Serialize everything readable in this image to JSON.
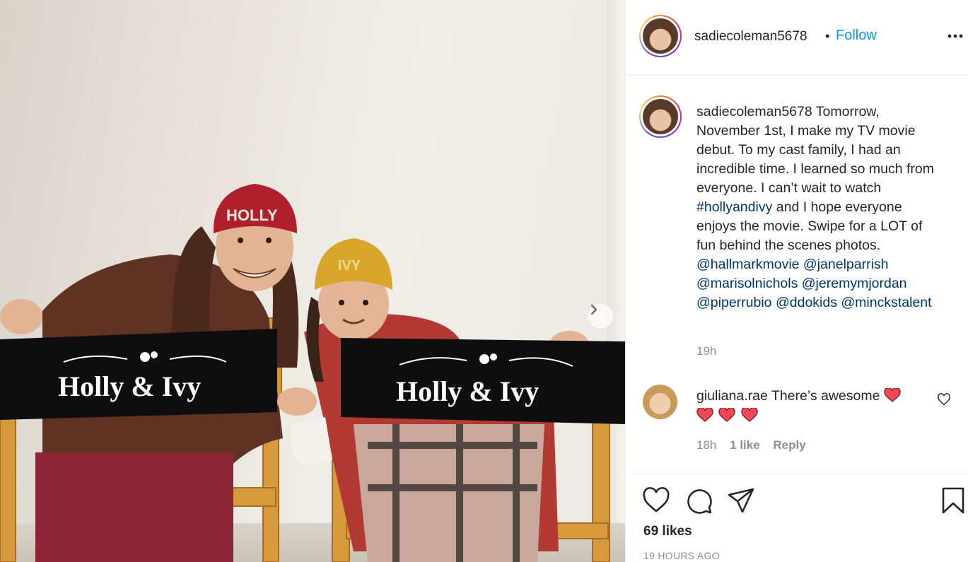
{
  "photo": {
    "alt": "",
    "beanie_left": "HOLLY",
    "beanie_right": "IVY",
    "chair_text": "Holly & Ivy"
  },
  "header": {
    "username": "sadiecoleman5678",
    "separator": "•",
    "follow_label": "Follow",
    "more_icon": "more-horizontal-icon"
  },
  "caption": {
    "username": "sadiecoleman5678",
    "text_1": "Tomorrow, November 1st, I make my TV movie debut. To my cast family, I had an incredible time. I learned so much from everyone. I can’t wait to watch",
    "hashtag": "#hollyandivy",
    "text_2": "and I hope everyone enjoys the movie. Swipe for a LOT of fun behind the scenes photos.",
    "mentions": [
      "@hallmarkmovie",
      "@janelparrish",
      "@marisolnichols",
      "@jeremymjordan",
      "@piperrubio",
      "@ddokids",
      "@minckstalent"
    ],
    "time": "19h"
  },
  "comment": {
    "username": "giuliana.rae",
    "text": "There’s awesome",
    "hearts_count": 4,
    "time": "18h",
    "likes": "1 like",
    "reply": "Reply"
  },
  "actions": {
    "likes": "69 likes",
    "timestamp": "19 HOURS AGO"
  },
  "colors": {
    "follow": "#0095f6",
    "tag": "#00376b",
    "muted": "#8e8e8e",
    "heart_red": "#ed4956"
  }
}
